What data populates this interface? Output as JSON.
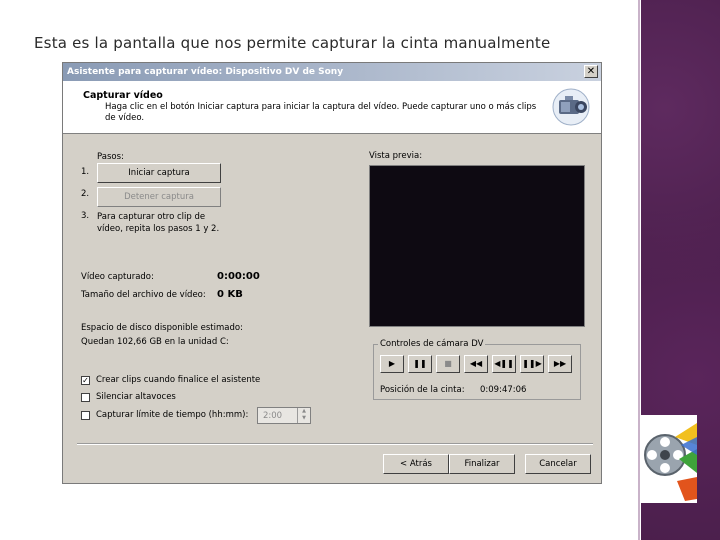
{
  "slide": {
    "title": "Esta es la pantalla que nos permite capturar la cinta manualmente"
  },
  "dialog": {
    "title": "Asistente para capturar vídeo: Dispositivo DV de Sony",
    "header_title": "Capturar vídeo",
    "header_desc": "Haga clic en el botón Iniciar captura para iniciar la captura del vídeo. Puede capturar uno o más clips de vídeo.",
    "steps_label": "Pasos:",
    "step1_num": "1.",
    "step1_button": "Iniciar captura",
    "step2_num": "2.",
    "step2_button": "Detener captura",
    "step3_num": "3.",
    "step3_text": "Para capturar otro clip de vídeo, repita los pasos 1 y 2.",
    "captured_label": "Vídeo capturado:",
    "captured_value": "0:00:00",
    "filesize_label": "Tamaño del archivo de vídeo:",
    "filesize_value": "0 KB",
    "disk_label": "Espacio de disco disponible estimado:",
    "disk_value": "Quedan 102,66 GB en la unidad C:",
    "preview_label": "Vista previa:",
    "camera_controls_label": "Controles de cámara DV",
    "tape_position_label": "Posición de la cinta:",
    "tape_position_value": "0:09:47:06",
    "opt_create_clips": "Crear clips cuando finalice el asistente",
    "opt_mute": "Silenciar altavoces",
    "opt_time_limit": "Capturar límite de tiempo (hh:mm):",
    "time_limit_value": "2:00",
    "btn_back": "< Atrás",
    "btn_finish": "Finalizar",
    "btn_cancel": "Cancelar",
    "close_glyph": "✕"
  },
  "camera_controls": {
    "play": "▶",
    "pause": "❚❚",
    "stop": "■",
    "rewind": "◀◀",
    "prev_frame": "◀❚❚",
    "next_frame": "❚❚▶",
    "fast_forward": "▶▶"
  },
  "checks": {
    "create_clips_checked": "✓"
  },
  "colors": {
    "side_band": "#4b1f4c",
    "dialog_bg": "#d4d0c8",
    "preview_bg": "#0e0a12"
  },
  "icons": {
    "header": "video-camera-icon",
    "slide": "windows-movie-maker-icon"
  }
}
